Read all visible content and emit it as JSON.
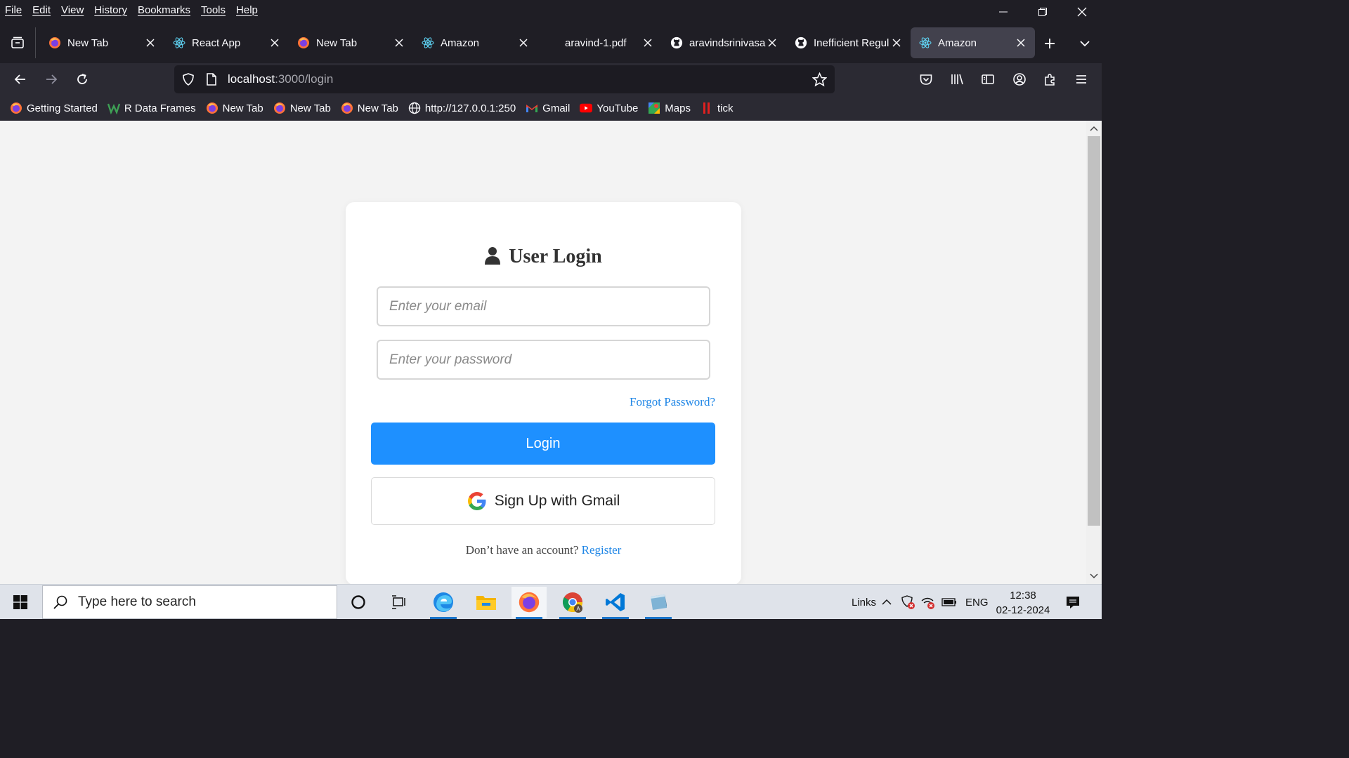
{
  "menu": [
    "File",
    "Edit",
    "View",
    "History",
    "Bookmarks",
    "Tools",
    "Help"
  ],
  "tabs": [
    {
      "title": "New Tab",
      "icon": "firefox-icon"
    },
    {
      "title": "React App",
      "icon": "react-icon"
    },
    {
      "title": "New Tab",
      "icon": "firefox-icon"
    },
    {
      "title": "Amazon",
      "icon": "react-icon"
    },
    {
      "title": "aravind-1.pdf",
      "icon": "none"
    },
    {
      "title": "aravindsrinivasa",
      "icon": "github-icon"
    },
    {
      "title": "Inefficient Regul",
      "icon": "github-icon"
    },
    {
      "title": "Amazon",
      "icon": "react-icon",
      "active": true
    }
  ],
  "url": {
    "host": "localhost",
    "rest": ":3000/login"
  },
  "bookmarks": [
    {
      "label": "Getting Started",
      "icon": "firefox-icon"
    },
    {
      "label": "R Data Frames",
      "icon": "w-icon"
    },
    {
      "label": "New Tab",
      "icon": "firefox-icon"
    },
    {
      "label": "New Tab",
      "icon": "firefox-icon"
    },
    {
      "label": "New Tab",
      "icon": "firefox-icon"
    },
    {
      "label": "http://127.0.0.1:250",
      "icon": "globe-icon"
    },
    {
      "label": "Gmail",
      "icon": "gmail-icon"
    },
    {
      "label": "YouTube",
      "icon": "youtube-icon"
    },
    {
      "label": "Maps",
      "icon": "maps-icon"
    },
    {
      "label": "tick",
      "icon": "tick-icon"
    }
  ],
  "login": {
    "title": "User Login",
    "email_placeholder": "Enter your email",
    "password_placeholder": "Enter your password",
    "forgot": "Forgot Password?",
    "login_button": "Login",
    "gmail_button": "Sign Up with Gmail",
    "no_account": "Don’t have an account?",
    "register": "Register",
    "accent": "#1e90ff"
  },
  "taskbar": {
    "search_placeholder": "Type here to search",
    "links": "Links",
    "lang": "ENG",
    "time": "12:38",
    "date": "02-12-2024"
  }
}
